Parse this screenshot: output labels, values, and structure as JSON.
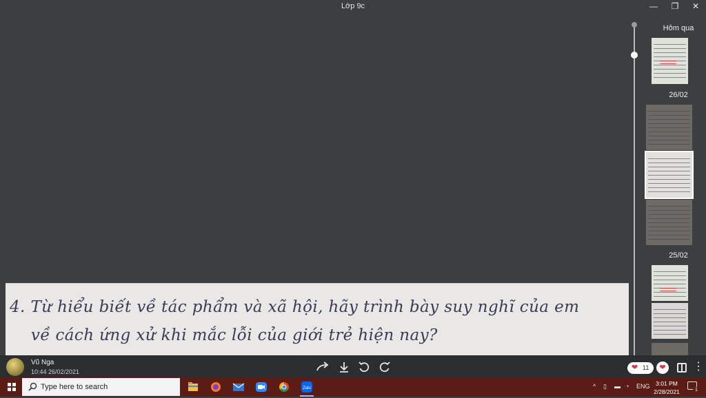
{
  "window": {
    "title": "Lớp 9c",
    "minimize": "—",
    "maximize": "❐",
    "close": "✕"
  },
  "photo": {
    "text": "4. Từ hiểu biết về tác phẩm và xã hội, hãy trình bày suy nghĩ của em\n    về cách ứng xử khi mắc lỗi của giới trẻ hiện nay?"
  },
  "sidebar": {
    "groups": [
      {
        "label": "Hôm qua"
      },
      {
        "label": "26/02"
      },
      {
        "label": "25/02"
      }
    ]
  },
  "footer": {
    "sender_name": "Vũ Nga",
    "sent_time": "10:44 26/02/2021",
    "reaction_count": "11",
    "icons": [
      "share-forward-icon",
      "download-icon",
      "rotate-left-icon",
      "rotate-right-icon",
      "heart-icon",
      "layout-icon",
      "more-icon"
    ]
  },
  "taskbar": {
    "search_placeholder": "Type here to search",
    "apps": [
      "file-explorer-icon",
      "firefox-icon",
      "mail-icon",
      "zoom-icon",
      "chrome-icon",
      "zalo-icon"
    ],
    "zalo_label": "Zalo",
    "language": "ENG",
    "time": "3:01 PM",
    "date": "2/28/2021",
    "notification_count": "1"
  },
  "colors": {
    "background": "#3c3e40",
    "taskbar": "#5b1c16",
    "heart": "#e0303d"
  }
}
